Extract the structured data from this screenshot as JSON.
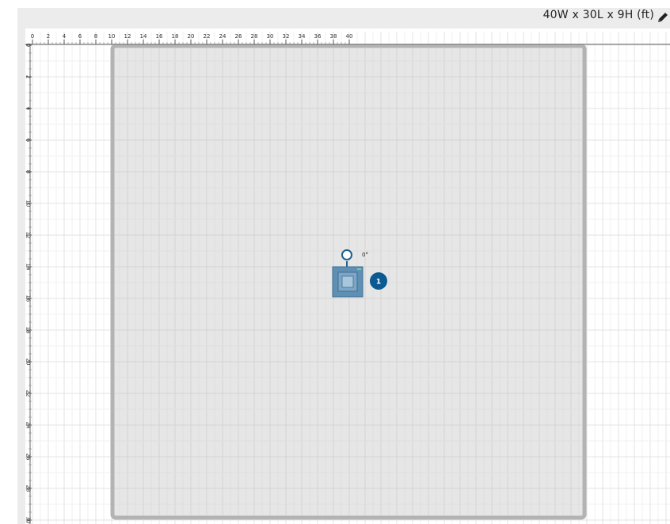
{
  "header": {
    "room_dimensions": "40W x 30L x 9H (ft)",
    "edit_icon": "pencil-icon"
  },
  "ruler": {
    "x_ticks": [
      "0",
      "2",
      "4",
      "6",
      "8",
      "10",
      "12",
      "14",
      "16",
      "18",
      "20",
      "22",
      "24",
      "26",
      "28",
      "30",
      "32",
      "34",
      "36",
      "38",
      "40"
    ],
    "y_ticks": [
      "0",
      "2",
      "4",
      "6",
      "8",
      "10",
      "12",
      "14",
      "16",
      "18",
      "20",
      "22",
      "24",
      "26",
      "28",
      "30"
    ]
  },
  "room": {
    "border_color": "#b3b3b3",
    "fill_color": "#e6e6e6"
  },
  "device": {
    "rotation_label": "0°",
    "badge_number": "1",
    "badge_color": "#0b5a92",
    "device_color": "#5f8fb3"
  }
}
